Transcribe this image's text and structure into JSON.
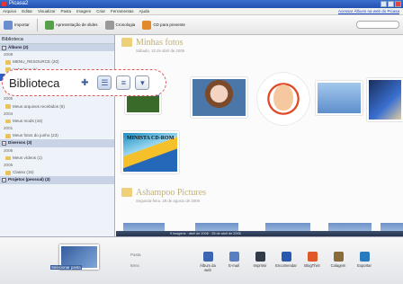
{
  "window": {
    "title": "Picasa2"
  },
  "menu": {
    "items": [
      "Arquivo",
      "Editar",
      "Visualizar",
      "Pasta",
      "Imagem",
      "Criar",
      "Ferramentas",
      "Ajuda"
    ],
    "right_link": "Acessar Álbuns na web do Picasa"
  },
  "toolbar": {
    "import_label": "Importar",
    "slideshow_label": "Apresentação de slides",
    "timeline_label": "Cronologia",
    "cd_label": "CD para presente"
  },
  "sidebar": {
    "header": "Biblioteca",
    "rows": [
      {
        "text": "Álbuns (2)",
        "kind": "group"
      },
      {
        "text": "2008",
        "kind": "year"
      },
      {
        "text": "MENU_RESOURCE (20)",
        "kind": "folder"
      },
      {
        "text": "Sobreloas (1)",
        "kind": "folder"
      },
      {
        "text": "Minhas fotos (9)",
        "kind": "selected"
      },
      {
        "text": "2006",
        "kind": "year"
      },
      {
        "text": "Ashampoo Pictures (42)",
        "kind": "folder"
      },
      {
        "text": "2005",
        "kind": "year"
      },
      {
        "text": "Meus arquivos recebidos (5)",
        "kind": "folder"
      },
      {
        "text": "2004",
        "kind": "year"
      },
      {
        "text": "Meus mods (44)",
        "kind": "folder"
      },
      {
        "text": "2001",
        "kind": "year"
      },
      {
        "text": "Meus fotos do junho (23)",
        "kind": "folder"
      },
      {
        "text": "Diversos (3)",
        "kind": "group"
      },
      {
        "text": "2006",
        "kind": "year"
      },
      {
        "text": "Meus vídeos (1)",
        "kind": "folder"
      },
      {
        "text": "2005",
        "kind": "year"
      },
      {
        "text": "Classo (15)",
        "kind": "folder"
      },
      {
        "text": "Projetos (pessoal) (3)",
        "kind": "group"
      }
    ]
  },
  "callout": {
    "title": "Biblioteca"
  },
  "main": {
    "section1": {
      "title": "Minhas fotos",
      "date": "Sábado, 22 de abril de 2006"
    },
    "section2": {
      "title": "Ashampoo Pictures",
      "date": "Segunda-feira, 28 de agosto de 2006"
    },
    "cd_thumb_caption": "MINISTA CD-ROM",
    "status": "9 imagens · abril de 2006 · 28 de abril de 2006"
  },
  "tray": {
    "selected_label": "Selecionar pasta",
    "side_labels": [
      "Pasta",
      "Itens"
    ],
    "buttons": [
      "Álbum da web",
      "E-mail",
      "Imprimir",
      "Encomendar",
      "BlogThis!",
      "Colagem",
      "Exportar"
    ],
    "colors": [
      "#3d66b0",
      "#5a7fc0",
      "#333a4a",
      "#2a5ab0",
      "#e0582a",
      "#8a6b3a",
      "#2a7ac0"
    ]
  }
}
